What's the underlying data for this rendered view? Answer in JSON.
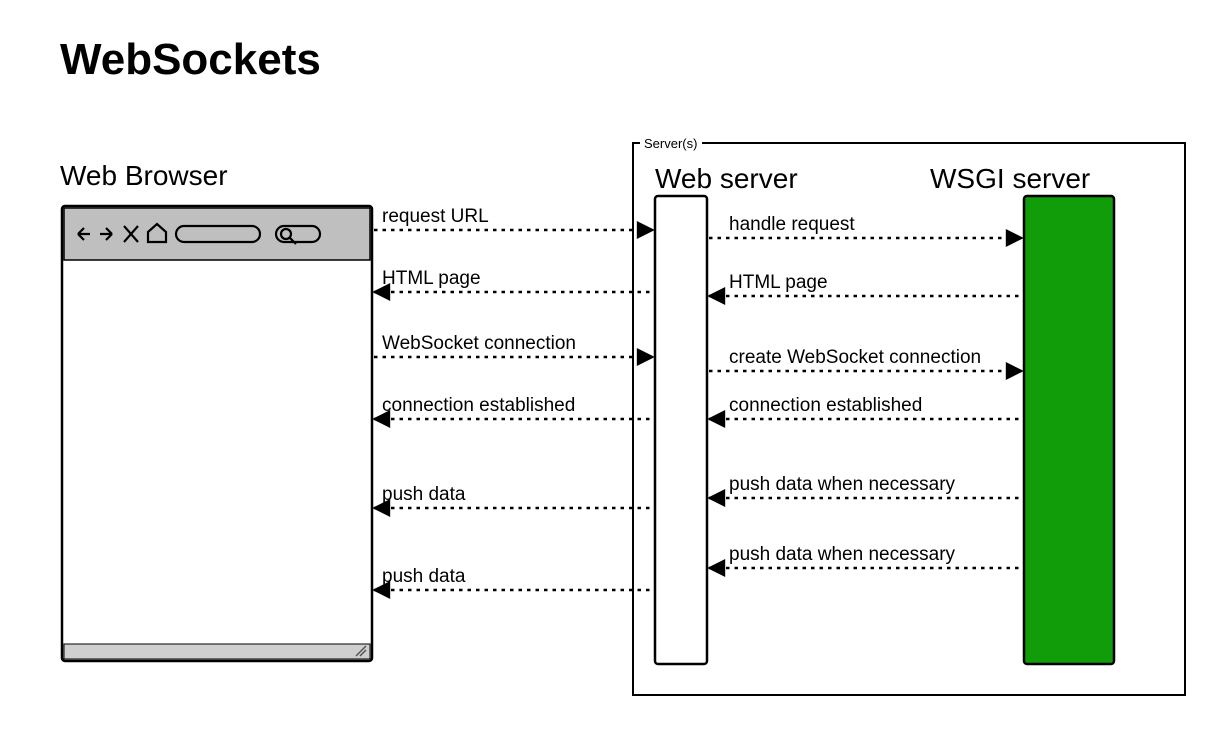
{
  "title": "WebSockets",
  "browser": {
    "label": "Web Browser"
  },
  "servers": {
    "group_label": "Server(s)",
    "web_label": "Web server",
    "wsgi_label": "WSGI server"
  },
  "left_arrows": [
    {
      "label": "request URL",
      "dir": "right"
    },
    {
      "label": "HTML page",
      "dir": "left"
    },
    {
      "label": "WebSocket connection",
      "dir": "right"
    },
    {
      "label": "connection established",
      "dir": "left"
    },
    {
      "label": "push data",
      "dir": "left"
    },
    {
      "label": "push data",
      "dir": "left"
    }
  ],
  "right_arrows": [
    {
      "label": "handle request",
      "dir": "right"
    },
    {
      "label": "HTML page",
      "dir": "left"
    },
    {
      "label": "create WebSocket connection",
      "dir": "right"
    },
    {
      "label": "connection established",
      "dir": "left"
    },
    {
      "label": "push data when necessary",
      "dir": "left"
    },
    {
      "label": "push data when necessary",
      "dir": "left"
    }
  ],
  "colors": {
    "wsgi_fill": "#119C0A",
    "browser_toolbar": "#BFBFBF",
    "browser_status": "#CFCFCF"
  }
}
